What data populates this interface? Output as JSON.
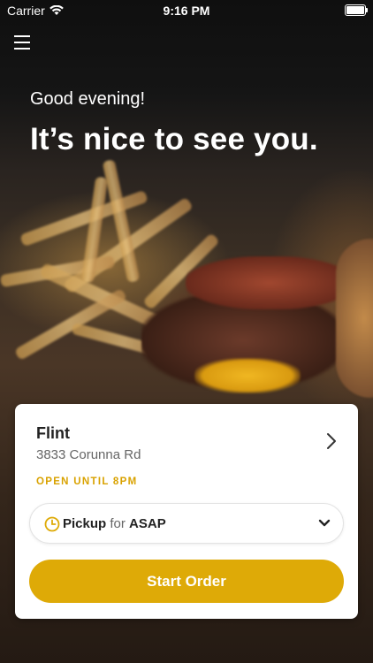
{
  "status_bar": {
    "carrier": "Carrier",
    "time": "9:16 PM"
  },
  "greeting": "Good evening!",
  "headline": "It’s nice to see you.",
  "location": {
    "name": "Flint",
    "address": "3833 Corunna Rd",
    "hours": "OPEN UNTIL 8PM"
  },
  "order_type": {
    "mode": "Pickup",
    "connector": "for",
    "time": "ASAP"
  },
  "start_button": "Start Order",
  "colors": {
    "accent": "#deaa07",
    "hours_text": "#d9a200"
  },
  "icons": [
    "wifi-icon",
    "battery-icon",
    "menu-icon",
    "chevron-right-icon",
    "clock-icon",
    "chevron-down-icon"
  ]
}
